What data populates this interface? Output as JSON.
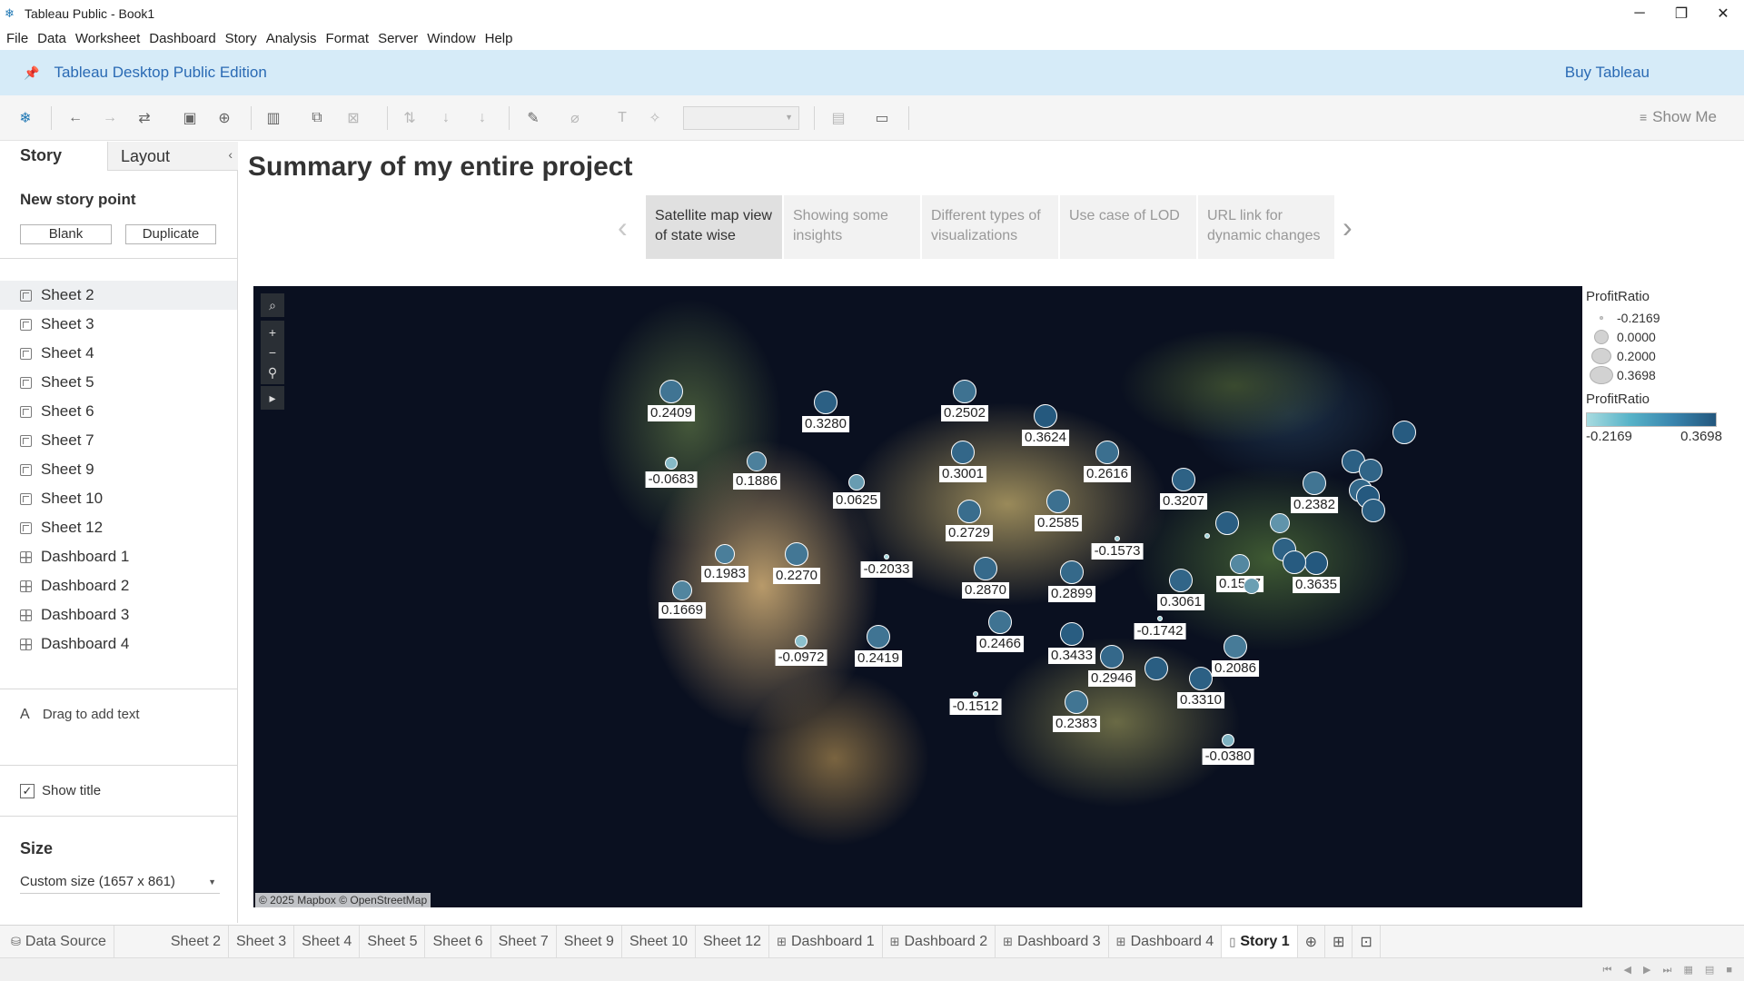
{
  "window": {
    "title": "Tableau Public - Book1",
    "minimize": "─",
    "restore": "❐",
    "close": "✕"
  },
  "menu": [
    "File",
    "Data",
    "Worksheet",
    "Dashboard",
    "Story",
    "Analysis",
    "Format",
    "Server",
    "Window",
    "Help"
  ],
  "banner": {
    "edition": "Tableau Desktop Public Edition",
    "buy": "Buy Tableau"
  },
  "toolbar": {
    "show_me": "Show Me"
  },
  "sidebar": {
    "tab_story": "Story",
    "tab_layout": "Layout",
    "new_story_point": "New story point",
    "blank": "Blank",
    "duplicate": "Duplicate",
    "sheets": [
      {
        "label": "Sheet 2",
        "kind": "sheet"
      },
      {
        "label": "Sheet 3",
        "kind": "sheet"
      },
      {
        "label": "Sheet 4",
        "kind": "sheet"
      },
      {
        "label": "Sheet 5",
        "kind": "sheet"
      },
      {
        "label": "Sheet 6",
        "kind": "sheet"
      },
      {
        "label": "Sheet 7",
        "kind": "sheet"
      },
      {
        "label": "Sheet 9",
        "kind": "sheet"
      },
      {
        "label": "Sheet 10",
        "kind": "sheet"
      },
      {
        "label": "Sheet 12",
        "kind": "sheet"
      },
      {
        "label": "Dashboard 1",
        "kind": "dashboard"
      },
      {
        "label": "Dashboard 2",
        "kind": "dashboard"
      },
      {
        "label": "Dashboard 3",
        "kind": "dashboard"
      },
      {
        "label": "Dashboard 4",
        "kind": "dashboard"
      }
    ],
    "drag_to_add_text": "Drag to add text",
    "show_title": "Show title",
    "show_title_checked": true,
    "size_heading": "Size",
    "size_value": "Custom size (1657 x 861)"
  },
  "story": {
    "title": "Summary of my entire project",
    "points": [
      {
        "label": "Satellite map view of state wise",
        "active": true
      },
      {
        "label": "Showing some insights",
        "active": false
      },
      {
        "label": "Different types of visualizations",
        "active": false
      },
      {
        "label": "Use case of LOD",
        "active": false
      },
      {
        "label": "URL link for dynamic changes",
        "active": false
      }
    ]
  },
  "map": {
    "credit": "© 2025 Mapbox © OpenStreetMap",
    "tools": [
      "search-icon",
      "zoom-in-icon",
      "zoom-out-icon",
      "pin-icon",
      "play-icon"
    ],
    "color_low": "#a7dbe0",
    "color_high": "#23577d",
    "marks": [
      {
        "label": "0.2409",
        "value": 0.2409
      },
      {
        "label": "0.3280",
        "value": 0.328
      },
      {
        "label": "0.2502",
        "value": 0.2502
      },
      {
        "label": "0.3624",
        "value": 0.3624
      },
      {
        "label": "-0.0683",
        "value": -0.0683
      },
      {
        "label": "0.1886",
        "value": 0.1886
      },
      {
        "label": "0.0625",
        "value": 0.0625
      },
      {
        "label": "0.3001",
        "value": 0.3001
      },
      {
        "label": "0.2616",
        "value": 0.2616
      },
      {
        "label": "0.3207",
        "value": 0.3207
      },
      {
        "label": "0.2382",
        "value": 0.2382
      },
      {
        "label": "0.2585",
        "value": 0.2585
      },
      {
        "label": "0.2729",
        "value": 0.2729
      },
      {
        "label": "-0.1573",
        "value": -0.1573
      },
      {
        "label": "0.1983",
        "value": 0.1983
      },
      {
        "label": "0.2270",
        "value": 0.227
      },
      {
        "label": "-0.2033",
        "value": -0.2033
      },
      {
        "label": "0.2870",
        "value": 0.287
      },
      {
        "label": "0.2899",
        "value": 0.2899
      },
      {
        "label": "0.1537",
        "value": 0.1537
      },
      {
        "label": "0.3635",
        "value": 0.3635
      },
      {
        "label": "0.1669",
        "value": 0.1669
      },
      {
        "label": "0.3061",
        "value": 0.3061
      },
      {
        "label": "-0.1742",
        "value": -0.1742
      },
      {
        "label": "-0.0972",
        "value": -0.0972
      },
      {
        "label": "0.2419",
        "value": 0.2419
      },
      {
        "label": "0.2466",
        "value": 0.2466
      },
      {
        "label": "0.3433",
        "value": 0.3433
      },
      {
        "label": "0.2946",
        "value": 0.2946
      },
      {
        "label": "0.2086",
        "value": 0.2086
      },
      {
        "label": "0.3310",
        "value": 0.331
      },
      {
        "label": "-0.1512",
        "value": -0.1512
      },
      {
        "label": "0.2383",
        "value": 0.2383
      },
      {
        "label": "-0.0380",
        "value": -0.038
      }
    ],
    "unlabeled_values": [
      0.35,
      0.33,
      0.31,
      0.3,
      0.36,
      0.34,
      0.1,
      -0.19,
      0.32,
      0.35,
      0.05,
      0.34,
      0.34
    ]
  },
  "legend": {
    "size_title": "ProfitRatio",
    "size_entries": [
      "-0.2169",
      "0.0000",
      "0.2000",
      "0.3698"
    ],
    "color_title": "ProfitRatio",
    "color_min": "-0.2169",
    "color_max": "0.3698"
  },
  "bottom_tabs": [
    {
      "label": "Data Source",
      "icon": "database-icon",
      "active": false
    },
    {
      "label": "Sheet 2",
      "icon": "",
      "active": false
    },
    {
      "label": "Sheet 3",
      "icon": "",
      "active": false
    },
    {
      "label": "Sheet 4",
      "icon": "",
      "active": false
    },
    {
      "label": "Sheet 5",
      "icon": "",
      "active": false
    },
    {
      "label": "Sheet 6",
      "icon": "",
      "active": false
    },
    {
      "label": "Sheet 7",
      "icon": "",
      "active": false
    },
    {
      "label": "Sheet 9",
      "icon": "",
      "active": false
    },
    {
      "label": "Sheet 10",
      "icon": "",
      "active": false
    },
    {
      "label": "Sheet 12",
      "icon": "",
      "active": false
    },
    {
      "label": "Dashboard 1",
      "icon": "dashboard-icon",
      "active": false
    },
    {
      "label": "Dashboard 2",
      "icon": "dashboard-icon",
      "active": false
    },
    {
      "label": "Dashboard 3",
      "icon": "dashboard-icon",
      "active": false
    },
    {
      "label": "Dashboard 4",
      "icon": "dashboard-icon",
      "active": false
    },
    {
      "label": "Story 1",
      "icon": "story-icon",
      "active": true
    }
  ]
}
